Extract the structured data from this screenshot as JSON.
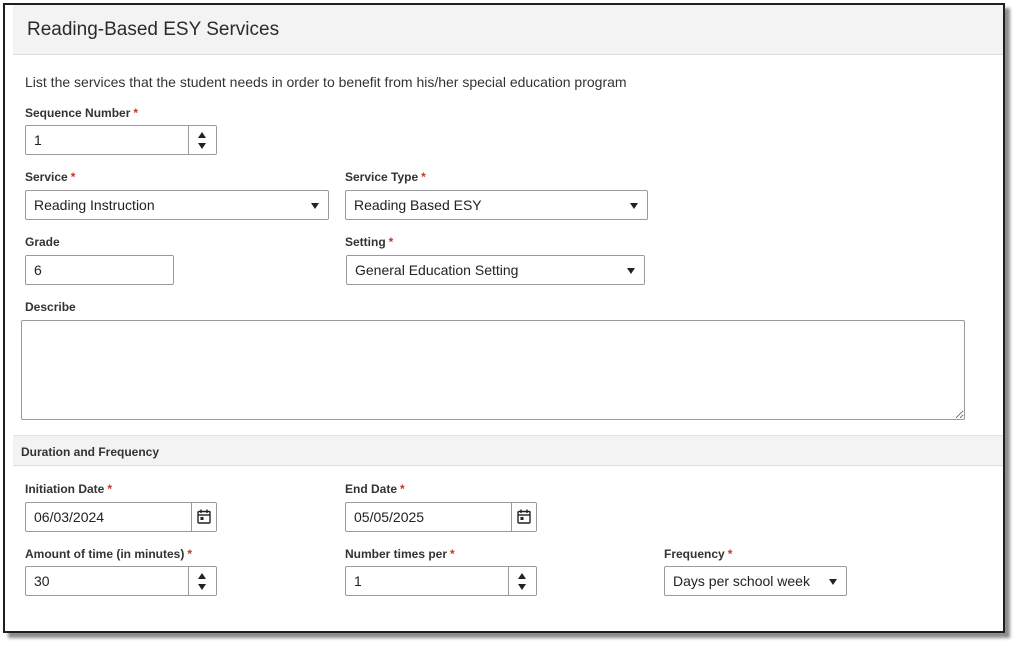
{
  "header": {
    "title": "Reading-Based ESY Services"
  },
  "intro": "List the services that the student needs in order to benefit from his/her special education program",
  "required_mark": "*",
  "sequence_number": {
    "label": "Sequence Number",
    "value": "1"
  },
  "service": {
    "label": "Service",
    "value": "Reading Instruction"
  },
  "service_type": {
    "label": "Service Type",
    "value": "Reading Based ESY"
  },
  "grade": {
    "label": "Grade",
    "value": "6"
  },
  "setting": {
    "label": "Setting",
    "value": "General Education Setting"
  },
  "describe": {
    "label": "Describe",
    "value": ""
  },
  "duration_section": {
    "title": "Duration and Frequency"
  },
  "initiation_date": {
    "label": "Initiation Date",
    "value": "06/03/2024"
  },
  "end_date": {
    "label": "End Date",
    "value": "05/05/2025"
  },
  "amount_of_time": {
    "label": "Amount of time (in minutes)",
    "value": "30"
  },
  "number_times_per": {
    "label": "Number times per",
    "value": "1"
  },
  "frequency": {
    "label": "Frequency",
    "value": "Days per school week"
  },
  "icons": {
    "spinner": "spinner-arrows-icon",
    "dropdown": "chevron-down-icon",
    "calendar": "calendar-icon"
  }
}
